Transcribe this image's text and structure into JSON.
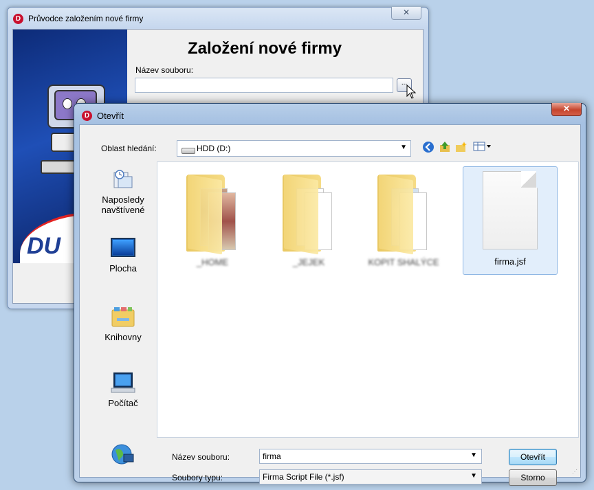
{
  "wizard": {
    "title": "Průvodce založením nové firmy",
    "close_glyph": "✕",
    "heading": "Založení nové firmy",
    "filename_label": "Název souboru:",
    "filename_value": "",
    "browse_label": "...",
    "brand_text": "DU"
  },
  "dialog": {
    "title": "Otevřít",
    "close_glyph": "✕",
    "look_in_label": "Oblast hledání:",
    "look_in_value": "HDD (D:)",
    "places": [
      {
        "label": "Naposledy navštívené",
        "icon": "recent-places-icon"
      },
      {
        "label": "Plocha",
        "icon": "desktop-icon"
      },
      {
        "label": "Knihovny",
        "icon": "libraries-icon"
      },
      {
        "label": "Počítač",
        "icon": "computer-icon"
      },
      {
        "label": "",
        "icon": "network-icon"
      }
    ],
    "items": [
      {
        "name": "_HOME",
        "type": "folder",
        "blurred": true
      },
      {
        "name": "_JEJEK",
        "type": "folder",
        "blurred": true
      },
      {
        "name": "KOPIT SHALÝCE",
        "type": "folder",
        "blurred": true
      },
      {
        "name": "firma.jsf",
        "type": "file",
        "selected": true
      }
    ],
    "filename_label": "Název souboru:",
    "filename_value": "firma",
    "filetype_label": "Soubory typu:",
    "filetype_value": "Firma Script File (*.jsf)",
    "open_button": "Otevřít",
    "cancel_button": "Storno"
  },
  "colors": {
    "desktop": "#b9d1ea",
    "dialog_close": "#c6452d",
    "selection": "#e2eefb",
    "app_logo": "#c8102e"
  }
}
